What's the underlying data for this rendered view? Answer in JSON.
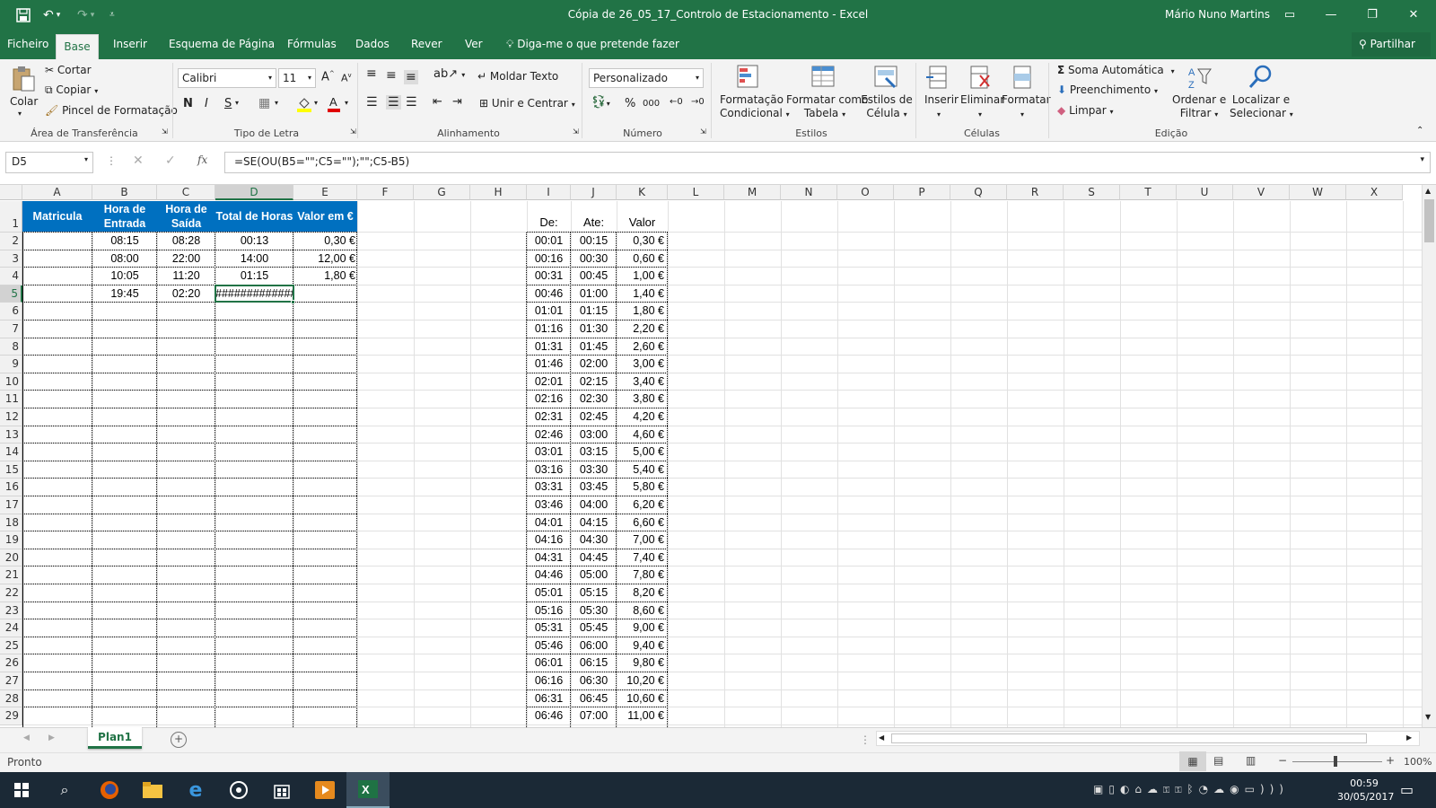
{
  "titlebar": {
    "title": "Cópia de 26_05_17_Controlo de Estacionamento  -  Excel",
    "user": "Mário Nuno Martins",
    "save_icon": "save-icon",
    "undo_icon": "undo-icon",
    "redo_icon": "redo-icon"
  },
  "tabs": [
    "Ficheiro",
    "Base",
    "Inserir",
    "Esquema de Página",
    "Fórmulas",
    "Dados",
    "Rever",
    "Ver"
  ],
  "tell_me": "Diga-me o que pretende fazer",
  "share": "Partilhar",
  "ribbon": {
    "clipboard": {
      "paste": "Colar",
      "cut": "Cortar",
      "copy": "Copiar",
      "format_painter": "Pincel de Formatação",
      "label": "Área de Transferência"
    },
    "font": {
      "name": "Calibri",
      "size": "11",
      "bold": "N",
      "italic": "I",
      "underline": "S",
      "label": "Tipo de Letra"
    },
    "alignment": {
      "wrap": "Moldar Texto",
      "merge": "Unir e Centrar",
      "label": "Alinhamento"
    },
    "number": {
      "format": "Personalizado",
      "percent": "%",
      "thousands": "000",
      "label": "Número"
    },
    "styles": {
      "conditional_1": "Formatação",
      "conditional_2": "Condicional",
      "table_1": "Formatar como",
      "table_2": "Tabela",
      "cell_1": "Estilos de",
      "cell_2": "Célula",
      "label": "Estilos"
    },
    "cells": {
      "insert": "Inserir",
      "delete": "Eliminar",
      "format": "Formatar",
      "label": "Células"
    },
    "editing": {
      "autosum": "Soma Automática",
      "fill": "Preenchimento",
      "clear": "Limpar",
      "sort_1": "Ordenar e",
      "sort_2": "Filtrar",
      "find_1": "Localizar e",
      "find_2": "Selecionar",
      "label": "Edição"
    }
  },
  "formula_bar": {
    "name_box": "D5",
    "formula": "=SE(OU(B5=\"\";C5=\"\");\"\";C5-B5)",
    "fx": "fx"
  },
  "columns": [
    "A",
    "B",
    "C",
    "D",
    "E",
    "F",
    "G",
    "H",
    "I",
    "J",
    "K",
    "L",
    "M",
    "N",
    "O",
    "P",
    "Q",
    "R",
    "S",
    "T",
    "U",
    "V",
    "W",
    "X"
  ],
  "rows": [
    "1",
    "2",
    "3",
    "4",
    "5",
    "6",
    "7",
    "8",
    "9",
    "10",
    "11",
    "12",
    "13",
    "14",
    "15",
    "16",
    "17",
    "18",
    "19",
    "20",
    "21",
    "22",
    "23",
    "24",
    "25",
    "26",
    "27",
    "28",
    "29"
  ],
  "main_table": {
    "headers": [
      "Matricula",
      "Hora de Entrada",
      "Hora de Saída",
      "Total de Horas",
      "Valor em €"
    ],
    "rows": [
      [
        "",
        "08:15",
        "08:28",
        "00:13",
        "0,30 €"
      ],
      [
        "",
        "08:00",
        "22:00",
        "14:00",
        "12,00 €"
      ],
      [
        "",
        "10:05",
        "11:20",
        "01:15",
        "1,80 €"
      ],
      [
        "",
        "19:45",
        "02:20",
        "#############",
        ""
      ]
    ]
  },
  "price_table": {
    "headers": [
      "De:",
      "Ate:",
      "Valor"
    ],
    "rows": [
      [
        "00:01",
        "00:15",
        "0,30 €"
      ],
      [
        "00:16",
        "00:30",
        "0,60 €"
      ],
      [
        "00:31",
        "00:45",
        "1,00 €"
      ],
      [
        "00:46",
        "01:00",
        "1,40 €"
      ],
      [
        "01:01",
        "01:15",
        "1,80 €"
      ],
      [
        "01:16",
        "01:30",
        "2,20 €"
      ],
      [
        "01:31",
        "01:45",
        "2,60 €"
      ],
      [
        "01:46",
        "02:00",
        "3,00 €"
      ],
      [
        "02:01",
        "02:15",
        "3,40 €"
      ],
      [
        "02:16",
        "02:30",
        "3,80 €"
      ],
      [
        "02:31",
        "02:45",
        "4,20 €"
      ],
      [
        "02:46",
        "03:00",
        "4,60 €"
      ],
      [
        "03:01",
        "03:15",
        "5,00 €"
      ],
      [
        "03:16",
        "03:30",
        "5,40 €"
      ],
      [
        "03:31",
        "03:45",
        "5,80 €"
      ],
      [
        "03:46",
        "04:00",
        "6,20 €"
      ],
      [
        "04:01",
        "04:15",
        "6,60 €"
      ],
      [
        "04:16",
        "04:30",
        "7,00 €"
      ],
      [
        "04:31",
        "04:45",
        "7,40 €"
      ],
      [
        "04:46",
        "05:00",
        "7,80 €"
      ],
      [
        "05:01",
        "05:15",
        "8,20 €"
      ],
      [
        "05:16",
        "05:30",
        "8,60 €"
      ],
      [
        "05:31",
        "05:45",
        "9,00 €"
      ],
      [
        "05:46",
        "06:00",
        "9,40 €"
      ],
      [
        "06:01",
        "06:15",
        "9,80 €"
      ],
      [
        "06:16",
        "06:30",
        "10,20 €"
      ],
      [
        "06:31",
        "06:45",
        "10,60 €"
      ],
      [
        "06:46",
        "07:00",
        "11,00 €"
      ]
    ]
  },
  "sheet_tabs": [
    "Plan1"
  ],
  "status": {
    "ready": "Pronto",
    "zoom": "100%"
  },
  "taskbar": {
    "time": "00:59",
    "date": "30/05/2017"
  }
}
